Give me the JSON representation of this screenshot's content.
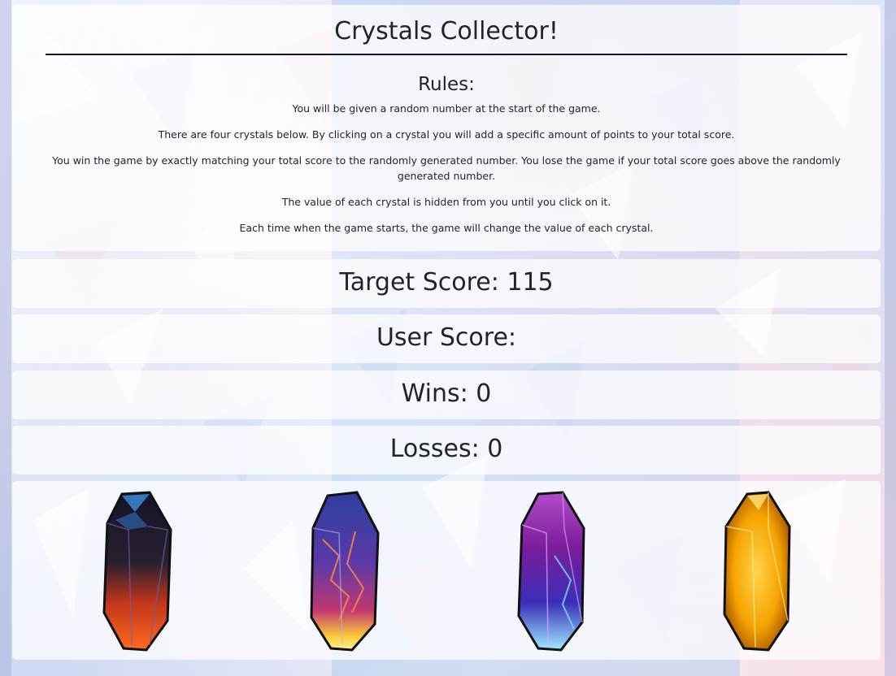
{
  "header": {
    "title": "Crystals Collector!",
    "rules_heading": "Rules:",
    "rules": [
      "You will be given a random number at the start of the game.",
      "There are four crystals below. By clicking on a crystal you will add a specific amount of points to your total score.",
      "You win the game by exactly matching your total score to the randomly generated number. You lose the game if your total score goes above the randomly generated number.",
      "The value of each crystal is hidden from you until you click on it.",
      "Each time when the game starts, the game will change the value of each crystal."
    ]
  },
  "scoreboard": {
    "target_label": "Target Score: 115",
    "user_label": "User Score:",
    "wins_label": "Wins: 0",
    "losses_label": "Losses: 0"
  },
  "crystals": [
    {
      "icon": "red-black-crystal-icon",
      "colors": [
        "#1a1a2e",
        "#ff5a1f"
      ]
    },
    {
      "icon": "blue-lava-crystal-icon",
      "colors": [
        "#3a4fbf",
        "#ffd23c"
      ]
    },
    {
      "icon": "purple-blue-crystal-icon",
      "colors": [
        "#8a1fa8",
        "#9ee8ff"
      ]
    },
    {
      "icon": "amber-crystal-icon",
      "colors": [
        "#ffb400",
        "#c96a00"
      ]
    }
  ]
}
